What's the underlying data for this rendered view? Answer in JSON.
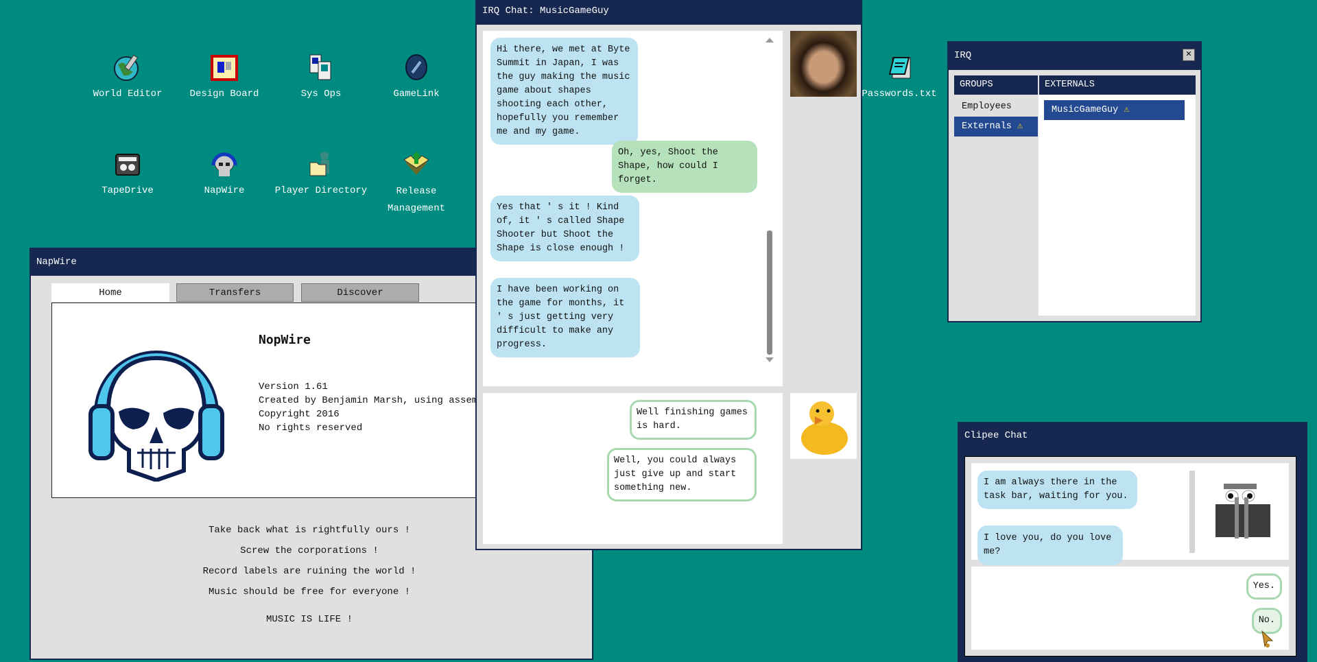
{
  "desktop": {
    "icons": [
      {
        "label": "World Editor",
        "icon": "globe-pencil-icon"
      },
      {
        "label": "Design Board",
        "icon": "board-icon"
      },
      {
        "label": "Sys Ops",
        "icon": "computers-icon"
      },
      {
        "label": "GameLink",
        "icon": "link-icon"
      },
      {
        "label": "TapeDrive",
        "icon": "tape-icon"
      },
      {
        "label": "NapWire",
        "icon": "skull-headphones-icon"
      },
      {
        "label": "Player Directory",
        "icon": "folder-user-icon"
      },
      {
        "label": "Release Management",
        "icon": "box-arrow-icon"
      },
      {
        "label": "Passwords.txt",
        "icon": "notepad-icon"
      }
    ]
  },
  "napwire": {
    "title": "NapWire",
    "tabs": [
      "Home",
      "Transfers",
      "Discover"
    ],
    "active_tab": "Home",
    "app_name": "NopWire",
    "info": [
      "Version 1.61",
      "Created by Benjamin Marsh, using assembly.",
      "Copyright 2016",
      "No rights reserved"
    ],
    "slogans": [
      "Take back what is rightfully ours !",
      "Screw the corporations !",
      "Record labels are ruining the world !",
      "Music should be free for everyone !"
    ],
    "motto": "MUSIC IS LIFE !"
  },
  "irq_chat": {
    "title": "IRQ Chat: MusicGameGuy",
    "messages": [
      {
        "from": "them",
        "text": "Hi there, we met at Byte Summit in Japan, I was the guy making the music game about shapes shooting each other, hopefully you remember me and my game."
      },
      {
        "from": "me",
        "text": "Oh, yes, Shoot the Shape, how could I forget."
      },
      {
        "from": "them",
        "text": "Yes that ' s it !  Kind of, it ' s called Shape Shooter but Shoot the Shape is close enough !"
      },
      {
        "from": "them",
        "text": "I have been working on the game for months, it ' s just getting very difficult to make any progress."
      }
    ],
    "reply_options": [
      "Well finishing games is hard.",
      "Well, you could always just give up and start something new."
    ]
  },
  "irq": {
    "title": "IRQ",
    "groups_header": "GROUPS",
    "externals_header": "EXTERNALS",
    "groups": [
      "Employees",
      "Externals"
    ],
    "selected_group": "Externals",
    "externals": [
      "MusicGameGuy"
    ],
    "warning_color": "#f5c518"
  },
  "clipee": {
    "title": "Clipee Chat",
    "messages": [
      "I am always there in the task bar, waiting for you.",
      "I love you, do you love me?"
    ],
    "replies": [
      "Yes.",
      "No."
    ]
  },
  "colors": {
    "desktop": "#008b80",
    "titlebar": "#16284f",
    "incoming": "#bde3f2",
    "outgoing": "#b6e2bb"
  }
}
